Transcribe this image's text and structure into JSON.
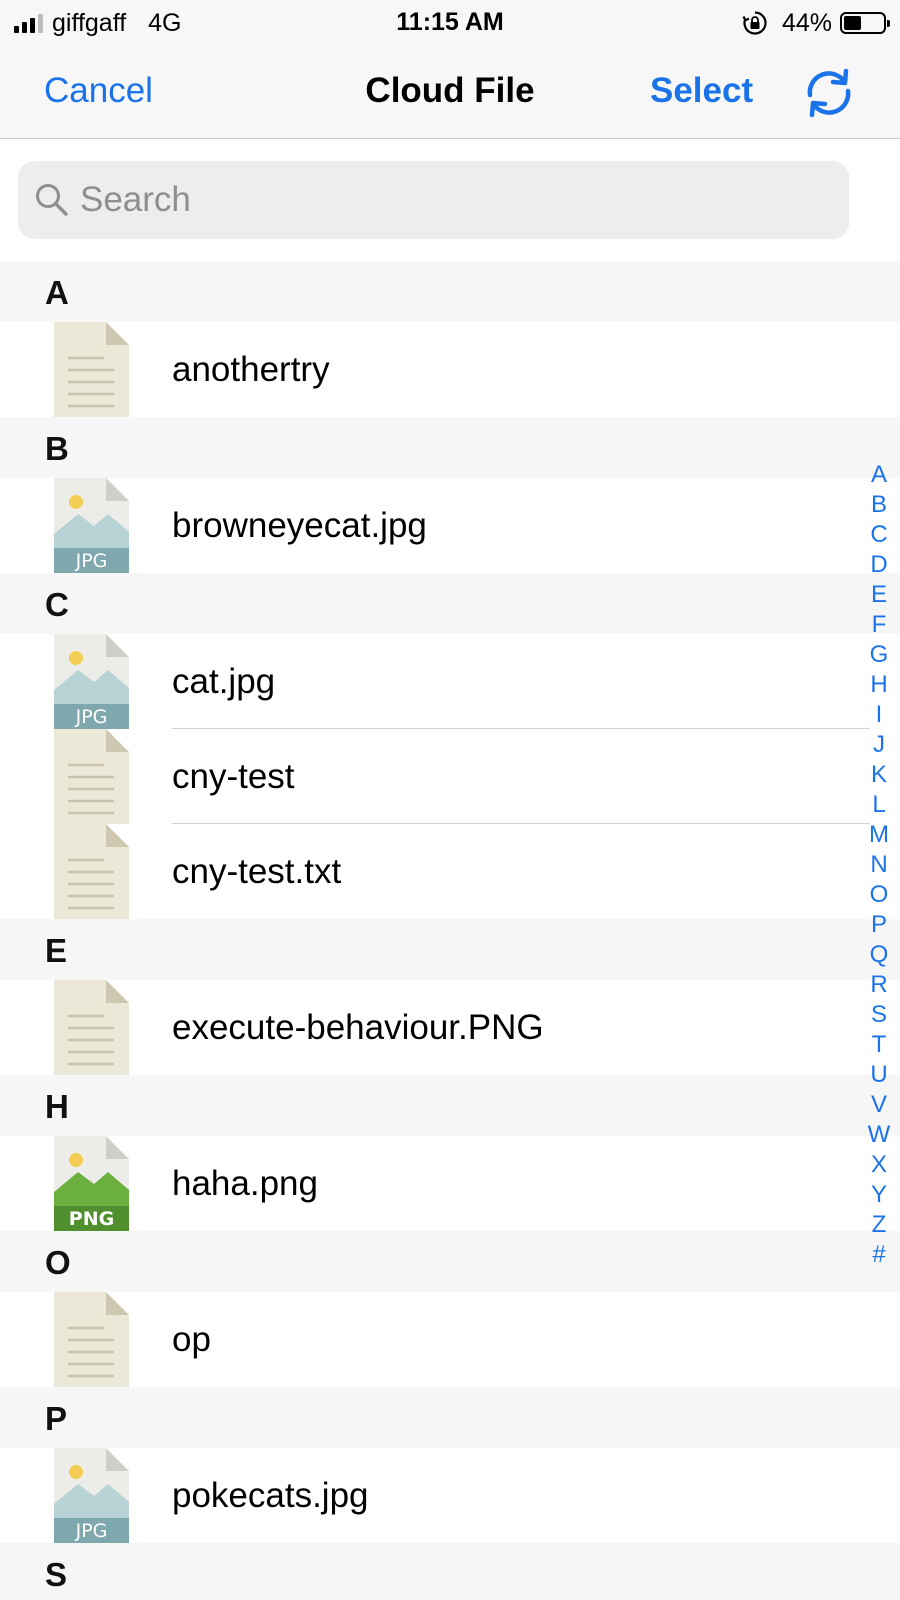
{
  "status_bar": {
    "carrier": "giffgaff",
    "network": "4G",
    "time": "11:15 AM",
    "battery_percent": "44%",
    "battery_level": 0.44,
    "icons": [
      "signal-icon",
      "orientation-lock-icon",
      "battery-icon"
    ]
  },
  "nav": {
    "cancel_label": "Cancel",
    "title": "Cloud File",
    "select_label": "Select",
    "refresh_icon": "refresh-icon"
  },
  "search": {
    "placeholder": "Search",
    "value": ""
  },
  "sections": [
    {
      "letter": "A",
      "files": [
        {
          "name": "anothertry",
          "icon": "doc"
        }
      ]
    },
    {
      "letter": "B",
      "files": [
        {
          "name": "browneyecat.jpg",
          "icon": "jpg"
        }
      ]
    },
    {
      "letter": "C",
      "files": [
        {
          "name": "cat.jpg",
          "icon": "jpg"
        },
        {
          "name": "cny-test",
          "icon": "doc"
        },
        {
          "name": "cny-test.txt",
          "icon": "doc"
        }
      ]
    },
    {
      "letter": "E",
      "files": [
        {
          "name": "execute-behaviour.PNG",
          "icon": "doc"
        }
      ]
    },
    {
      "letter": "H",
      "files": [
        {
          "name": "haha.png",
          "icon": "png"
        }
      ]
    },
    {
      "letter": "O",
      "files": [
        {
          "name": "op",
          "icon": "doc"
        }
      ]
    },
    {
      "letter": "P",
      "files": [
        {
          "name": "pokecats.jpg",
          "icon": "jpg"
        }
      ]
    },
    {
      "letter": "S",
      "files": []
    }
  ],
  "file_icon_labels": {
    "jpg": "JPG",
    "png": "PNG"
  },
  "index": [
    "A",
    "B",
    "C",
    "D",
    "E",
    "F",
    "G",
    "H",
    "I",
    "J",
    "K",
    "L",
    "M",
    "N",
    "O",
    "P",
    "Q",
    "R",
    "S",
    "T",
    "U",
    "V",
    "W",
    "X",
    "Y",
    "Z",
    "#"
  ],
  "colors": {
    "accent": "#1a73e8",
    "section_bg": "#f6f6f7",
    "doc_icon": "#ece8d8",
    "jpg_band": "#7fa8ae",
    "png_band": "#4f8f2e"
  }
}
